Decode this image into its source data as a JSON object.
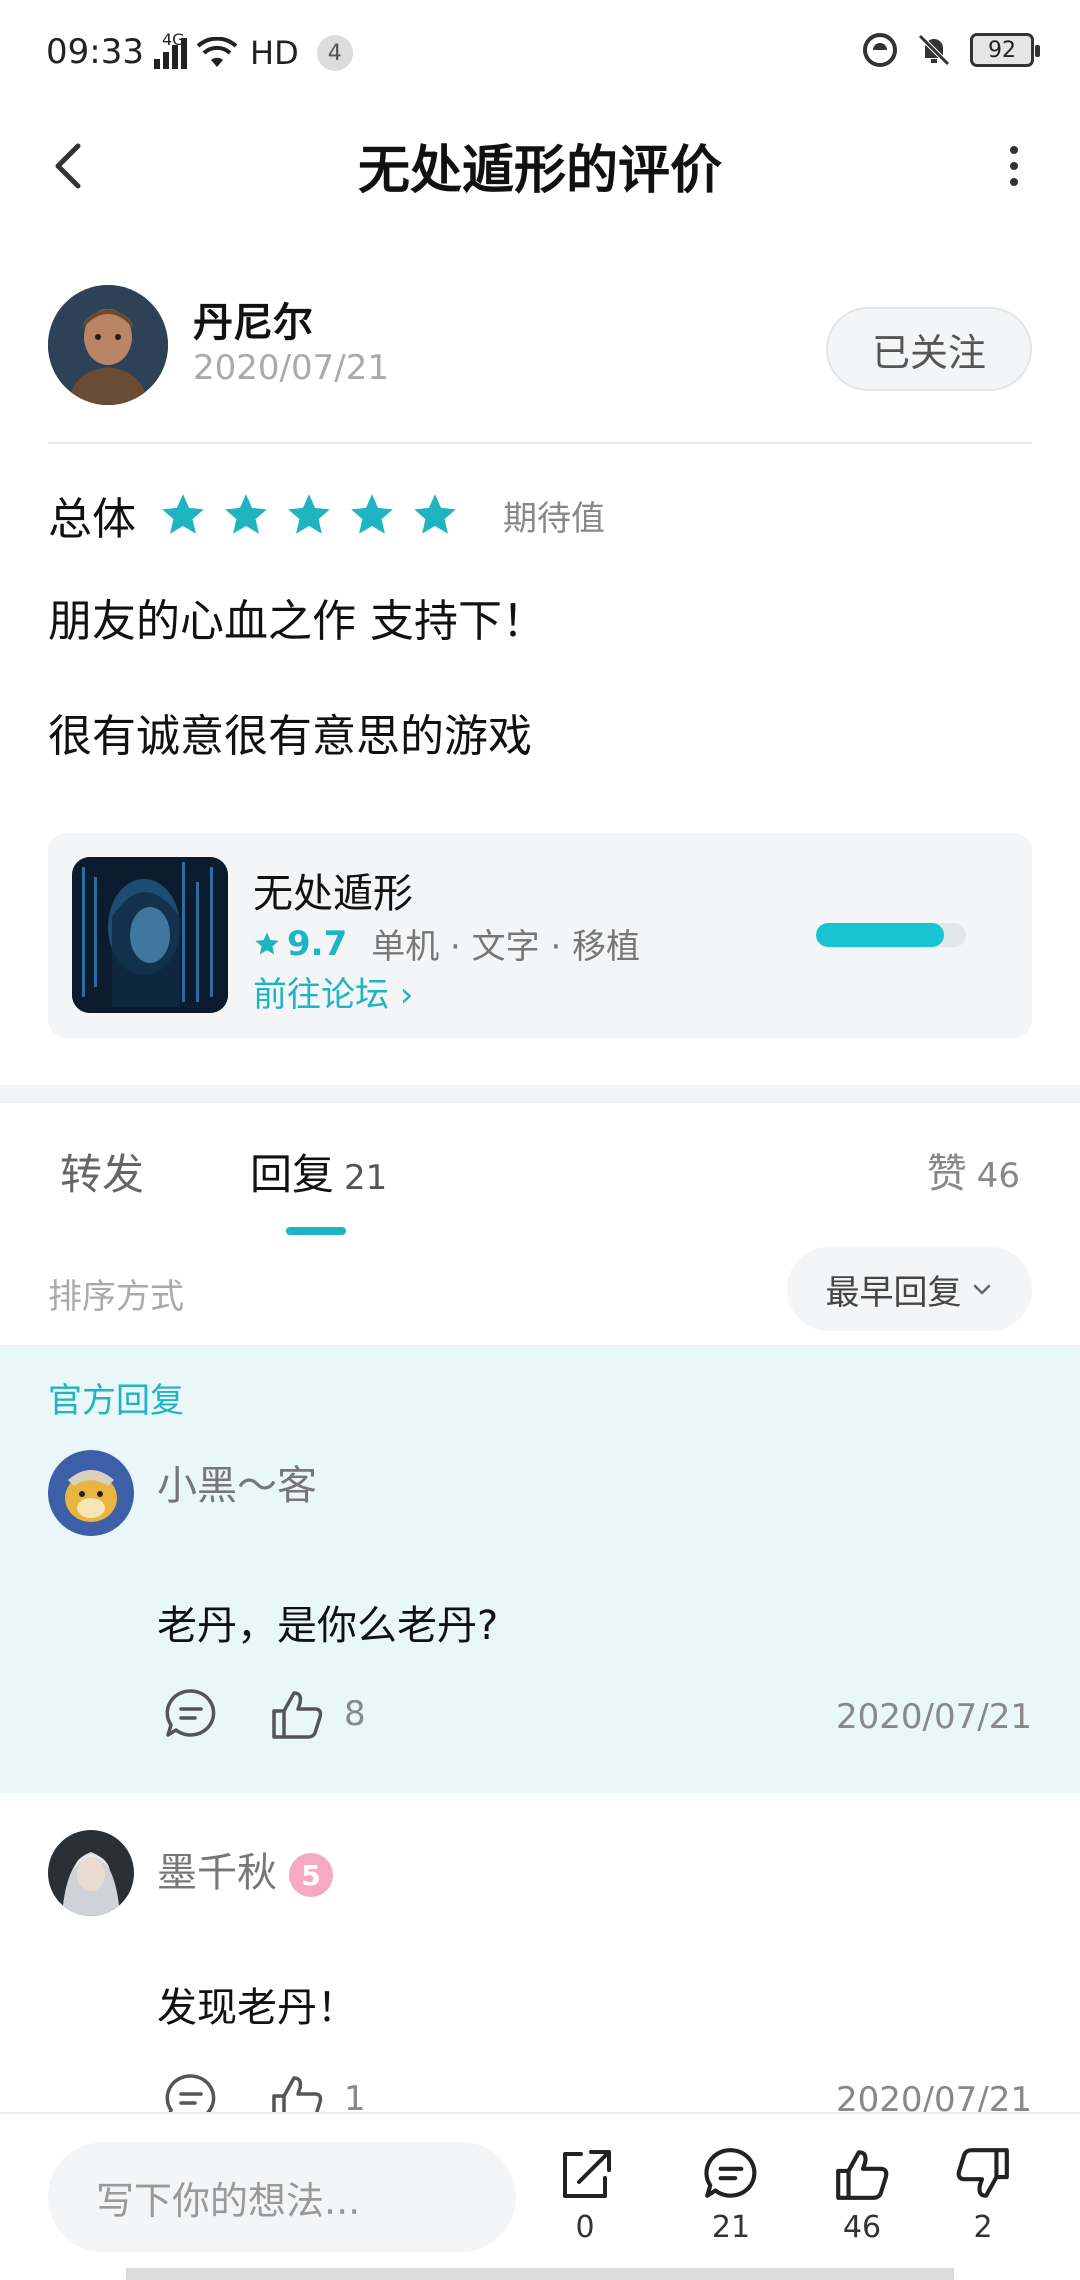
{
  "status_bar": {
    "time": "09:33",
    "network": "4G",
    "hd": "HD",
    "notif_count": "4",
    "battery": "92"
  },
  "nav": {
    "title": "无处遁形的评价"
  },
  "author": {
    "name": "丹尼尔",
    "date": "2020/07/21",
    "follow_label": "已关注"
  },
  "rating": {
    "label": "总体",
    "stars": 5,
    "tag": "期待值"
  },
  "review": {
    "line1": "朋友的心血之作 支持下！",
    "line2": "很有诚意很有意思的游戏"
  },
  "game": {
    "name": "无处遁形",
    "score": "9.7",
    "tags": "单机 · 文字 · 移植",
    "forum_link": "前往论坛 ›",
    "progress": 0.85
  },
  "tabs": {
    "forward": "转发",
    "reply": "回复",
    "reply_count": "21",
    "like": "赞",
    "like_count": "46"
  },
  "sort": {
    "label": "排序方式",
    "selected": "最早回复"
  },
  "official": {
    "label": "官方回复"
  },
  "comments": [
    {
      "name": "小黑～客",
      "text": "老丹，是你么老丹?",
      "likes": "8",
      "date": "2020/07/21"
    },
    {
      "name": "墨千秋",
      "level": "5",
      "text": "发现老丹！",
      "likes": "1",
      "date": "2020/07/21"
    }
  ],
  "bottom": {
    "placeholder": "写下你的想法...",
    "share_count": "0",
    "comment_count": "21",
    "like_count": "46",
    "dislike_count": "2"
  },
  "colors": {
    "accent": "#1fb4c2",
    "official_bg": "#e9f7f9"
  }
}
